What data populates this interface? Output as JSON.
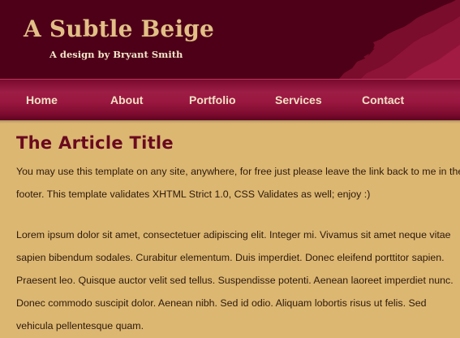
{
  "header": {
    "title": "A Subtle Beige",
    "subtitle": "A design by Bryant Smith"
  },
  "nav": {
    "items": [
      "Home",
      "About",
      "Portfolio",
      "Services",
      "Contact"
    ]
  },
  "article": {
    "title": "The Article Title",
    "paragraphs": [
      "You may use this template on any site, anywhere, for free just please leave the link back to me in the footer. This template validates XHTML Strict 1.0, CSS Validates as well; enjoy :)",
      "Lorem ipsum dolor sit amet, consectetuer adipiscing elit. Integer mi. Vivamus sit amet neque vitae sapien bibendum sodales. Curabitur elementum. Duis imperdiet. Donec eleifend porttitor sapien. Praesent leo. Quisque auctor velit sed tellus. Suspendisse potenti. Aenean laoreet imperdiet nunc. Donec commodo suscipit dolor. Aenean nibh. Sed id odio. Aliquam lobortis risus ut felis. Sed vehicula pellentesque quam."
    ]
  },
  "colors": {
    "header_bg": "#4e0019",
    "nav_bg": "#9a1740",
    "page_bg": "#dcb772",
    "title_text": "#e2bf86",
    "article_title": "#6a0a1f"
  }
}
